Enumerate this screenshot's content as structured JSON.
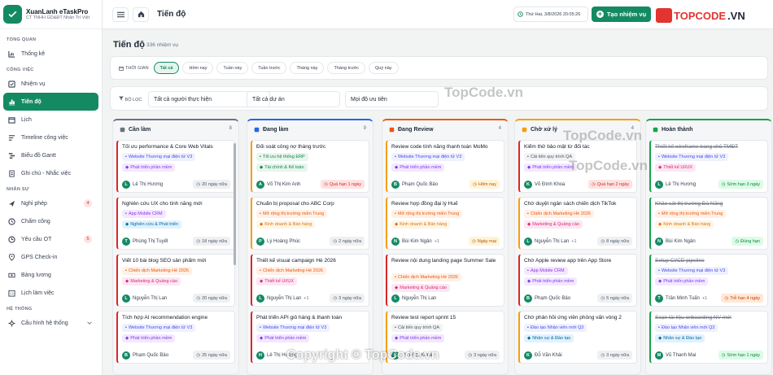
{
  "brand": {
    "name": "XuanLanh eTaskPro",
    "sub": "CT TNHH GD&ĐT Nhân Trí Việt"
  },
  "sidebar": {
    "sections": [
      {
        "title": "TỔNG QUAN",
        "items": [
          {
            "label": "Thống kê",
            "icon": "chart-icon"
          }
        ]
      },
      {
        "title": "CÔNG VIỆC",
        "items": [
          {
            "label": "Nhiệm vụ",
            "icon": "task-icon"
          },
          {
            "label": "Tiến độ",
            "icon": "progress-icon",
            "active": true
          },
          {
            "label": "Lịch",
            "icon": "calendar-icon"
          },
          {
            "label": "Timeline công việc",
            "icon": "timeline-icon"
          },
          {
            "label": "Biểu đồ Gantt",
            "icon": "gantt-icon"
          },
          {
            "label": "Ghi chú - Nhắc việc",
            "icon": "note-icon"
          }
        ]
      },
      {
        "title": "NHÂN SỰ",
        "items": [
          {
            "label": "Nghỉ phép",
            "icon": "plane-icon",
            "badge": "4"
          },
          {
            "label": "Chấm công",
            "icon": "clock-icon"
          },
          {
            "label": "Yêu cầu OT",
            "icon": "ot-icon",
            "badge": "5"
          },
          {
            "label": "GPS Check-in",
            "icon": "pin-icon"
          },
          {
            "label": "Bảng lương",
            "icon": "money-icon"
          },
          {
            "label": "Lịch làm việc",
            "icon": "schedule-icon"
          }
        ]
      },
      {
        "title": "HỆ THỐNG",
        "items": [
          {
            "label": "Cấu hình hệ thống",
            "icon": "gear-icon",
            "chevron": true
          }
        ]
      }
    ]
  },
  "topbar": {
    "title": "Tiến độ",
    "date": "Thứ Hai, 3/8/2026 20:05:26",
    "create_label": "Tạo nhiệm vụ",
    "site_a": "TOPCODE",
    "site_b": ".VN"
  },
  "page": {
    "title": "Tiến độ",
    "count": "336 nhiệm vụ"
  },
  "time_filter": {
    "label": "THỜI GIAN",
    "chips": [
      "Tất cả",
      "Hôm nay",
      "Tuần này",
      "Tuần trước",
      "Tháng này",
      "Tháng trước",
      "Quý này"
    ],
    "active": 0
  },
  "filters": {
    "label": "BỘ LỌC",
    "assignee": "Tất cả người thực hiện",
    "project": "Tất cả dự án",
    "priority": "Mọi độ ưu tiên"
  },
  "columns": [
    {
      "title": "Cần làm",
      "count": "8",
      "color": "#6b7280",
      "cards": [
        {
          "title": "Tối ưu performance & Core Web Vitals",
          "project": "Website Thương mại điện tử V3",
          "pc": "",
          "category": "Phát triển phần mềm",
          "cc": "",
          "initial": "L",
          "assignee": "Lê Thị Hương",
          "more": "",
          "due": "20 ngày nữa",
          "dc": "n",
          "accent": "#dc2626"
        },
        {
          "title": "Nghiên cứu UX cho tính năng mới",
          "project": "App Mobile CRM",
          "pc": "p",
          "category": "Nghiên cứu & Phát triển",
          "cc": "b",
          "initial": "T",
          "assignee": "Phùng Thị Tuyết",
          "more": "",
          "due": "18 ngày nữa",
          "dc": "n",
          "accent": "#dc2626"
        },
        {
          "title": "Viết 10 bài blog SEO sản phẩm mới",
          "project": "Chiến dịch Marketing Hè 2026",
          "pc": "o",
          "category": "Marketing & Quảng cáo",
          "cc": "p",
          "initial": "L",
          "assignee": "Nguyễn Thị Lan",
          "more": "",
          "due": "20 ngày nữa",
          "dc": "n",
          "accent": "#dc2626"
        },
        {
          "title": "Tích hợp AI recommendation engine",
          "project": "Website Thương mại điện tử V3",
          "pc": "",
          "category": "Phát triển phần mềm",
          "cc": "",
          "initial": "B",
          "assignee": "Phạm Quốc Bảo",
          "more": "",
          "due": "25 ngày nữa",
          "dc": "n",
          "accent": "#dc2626"
        }
      ]
    },
    {
      "title": "Đang làm",
      "count": "9",
      "color": "#2563eb",
      "cards": [
        {
          "title": "Đối soát công nợ tháng trước",
          "project": "Tối ưu hệ thống ERP",
          "pc": "g",
          "category": "Tài chính & Kế toán",
          "cc": "g",
          "initial": "A",
          "assignee": "Võ Thị Kim Anh",
          "more": "",
          "due": "Quá hạn 1 ngày",
          "dc": "r",
          "accent": "#f59e0b"
        },
        {
          "title": "Chuẩn bị proposal cho ABC Corp",
          "project": "Mở rộng thị trường miền Trung",
          "pc": "o",
          "category": "Kinh doanh & Bán hàng",
          "cc": "o",
          "initial": "P",
          "assignee": "Lý Hoàng Phúc",
          "more": "",
          "due": "2 ngày nữa",
          "dc": "n",
          "accent": "#f59e0b"
        },
        {
          "title": "Thiết kế visual campaign Hè 2026",
          "project": "Chiến dịch Marketing Hè 2026",
          "pc": "o",
          "category": "Thiết kế UI/UX",
          "cc": "p",
          "initial": "L",
          "assignee": "Nguyễn Thị Lan",
          "more": "+1",
          "due": "3 ngày nữa",
          "dc": "n",
          "accent": "#dc2626"
        },
        {
          "title": "Phát triển API giỏ hàng & thanh toán",
          "project": "Website Thương mại điện tử V3",
          "pc": "",
          "category": "Phát triển phần mềm",
          "cc": "",
          "initial": "H",
          "assignee": "Lê Thị Hương",
          "more": "",
          "due": "",
          "dc": "n",
          "accent": "#dc2626"
        }
      ]
    },
    {
      "title": "Đang Review",
      "count": "4",
      "color": "#ea580c",
      "cards": [
        {
          "title": "Review code tính năng thanh toán MoMo",
          "project": "Website Thương mại điện tử V3",
          "pc": "",
          "category": "Phát triển phần mềm",
          "cc": "",
          "initial": "B",
          "assignee": "Phạm Quốc Bảo",
          "more": "",
          "due": "Hôm nay",
          "dc": "y",
          "accent": "#f59e0b"
        },
        {
          "title": "Review hợp đồng đại lý Huế",
          "project": "Mở rộng thị trường miền Trung",
          "pc": "o",
          "category": "Kinh doanh & Bán hàng",
          "cc": "o",
          "initial": "N",
          "assignee": "Bùi Kim Ngân",
          "more": "+1",
          "due": "Ngày mai",
          "dc": "y",
          "accent": "#f59e0b"
        },
        {
          "title": "Review nội dung landing page Summer Sale",
          "project": "Chiến dịch Marketing Hè 2026",
          "pc": "o",
          "category": "Marketing & Quảng cáo",
          "cc": "p",
          "initial": "L",
          "assignee": "Nguyễn Thị Lan",
          "more": "",
          "due": "",
          "dc": "n",
          "accent": "#dc2626",
          "two": true
        },
        {
          "title": "Review test report sprint 15",
          "project": "Cải tiến quy trình QA",
          "pc": "s",
          "category": "Phát triển phần mềm",
          "cc": "",
          "initial": "K",
          "assignee": "Võ Đình Khoa",
          "more": "",
          "due": "3 ngày nữa",
          "dc": "n",
          "accent": "#f59e0b"
        }
      ]
    },
    {
      "title": "Chờ xử lý",
      "count": "4",
      "color": "#f59e0b",
      "cards": [
        {
          "title": "Kiểm thử bảo mật từ đối tác",
          "project": "Cải tiến quy trình QA",
          "pc": "s",
          "category": "Phát triển phần mềm",
          "cc": "",
          "initial": "K",
          "assignee": "Võ Đình Khoa",
          "more": "",
          "due": "Quá hạn 2 ngày",
          "dc": "r",
          "accent": "#dc2626"
        },
        {
          "title": "Chờ duyệt ngân sách chiến dịch TikTok",
          "project": "Chiến dịch Marketing Hè 2026",
          "pc": "o",
          "category": "Marketing & Quảng cáo",
          "cc": "p",
          "initial": "L",
          "assignee": "Nguyễn Thị Lan",
          "more": "+1",
          "due": "8 ngày nữa",
          "dc": "n",
          "accent": "#f59e0b"
        },
        {
          "title": "Chờ Apple review app trên App Store",
          "project": "App Mobile CRM",
          "pc": "p",
          "category": "Phát triển phần mềm",
          "cc": "",
          "initial": "B",
          "assignee": "Phạm Quốc Bảo",
          "more": "",
          "due": "5 ngày nữa",
          "dc": "n",
          "accent": "#dc2626"
        },
        {
          "title": "Chờ phản hồi ứng viên phỏng vấn vòng 2",
          "project": "Đào tạo Nhân viên mới Q3",
          "pc": "",
          "category": "Nhân sự & Đào tạo",
          "cc": "b",
          "initial": "K",
          "assignee": "Đỗ Văn Khải",
          "more": "",
          "due": "3 ngày nữa",
          "dc": "n",
          "accent": "#f59e0b"
        }
      ]
    },
    {
      "title": "Hoàn thành",
      "count": "",
      "color": "#16a34a",
      "cards": [
        {
          "title": "Thiết kế wireframe trang chủ TMĐT",
          "project": "Website Thương mại điện tử V3",
          "pc": "",
          "category": "Thiết kế UI/UX",
          "cc": "p",
          "initial": "L",
          "assignee": "Lê Thị Hương",
          "more": "",
          "due": "Sớm hạn 3 ngày",
          "dc": "g",
          "accent": "#16a34a",
          "strike": true
        },
        {
          "title": "Khảo sát thị trường Đà Nẵng",
          "project": "Mở rộng thị trường miền Trung",
          "pc": "o",
          "category": "Kinh doanh & Bán hàng",
          "cc": "o",
          "initial": "N",
          "assignee": "Bùi Kim Ngân",
          "more": "",
          "due": "Đúng hạn",
          "dc": "g",
          "accent": "#16a34a",
          "strike": true
        },
        {
          "title": "Setup CI/CD pipeline",
          "project": "Website Thương mại điện tử V3",
          "pc": "",
          "category": "Phát triển phần mềm",
          "cc": "",
          "initial": "T",
          "assignee": "Trần Minh Tuấn",
          "more": "+1",
          "due": "Trễ hạn 4 ngày",
          "dc": "or",
          "accent": "#16a34a",
          "strike": true
        },
        {
          "title": "Soạn tài liệu onboarding NV mới",
          "project": "Đào tạo Nhân viên mới Q3",
          "pc": "",
          "category": "Nhân sự & Đào tạo",
          "cc": "b",
          "initial": "M",
          "assignee": "Vũ Thanh Mai",
          "more": "",
          "due": "Sớm hạn 1 ngày",
          "dc": "g",
          "accent": "#16a34a",
          "strike": true
        }
      ]
    }
  ],
  "watermarks": [
    "TopCode.vn",
    "TopCode.vn",
    "TopCode.vn"
  ],
  "copyright": "Copyright © TopCode.vn"
}
